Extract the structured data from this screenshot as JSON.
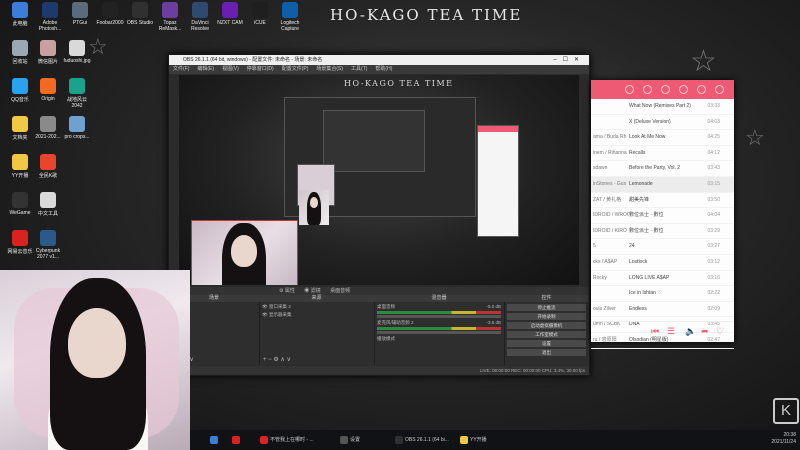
{
  "wallpaper": {
    "title": "HO-KAGO TEA TIME"
  },
  "desktop_icons": [
    {
      "label": "此电脑",
      "color": "#3b7dd8"
    },
    {
      "label": "Adobe Photosh...",
      "color": "#1c3a6e"
    },
    {
      "label": "PTGui",
      "color": "#5a6b7c"
    },
    {
      "label": "Foobar2000",
      "color": "#222222"
    },
    {
      "label": "OBS Studio",
      "color": "#303030"
    },
    {
      "label": "Topaz ReMask...",
      "color": "#6b3fa0"
    },
    {
      "label": "DaVinci Resolve",
      "color": "#2e4a70"
    },
    {
      "label": "NZXT CAM",
      "color": "#6a1fb0"
    },
    {
      "label": "iCUE",
      "color": "#1f1f1f"
    },
    {
      "label": "Logitech Capture",
      "color": "#0e5fa8"
    },
    {
      "label": "回收站",
      "color": "#9aa8b5"
    },
    {
      "label": "微信图片",
      "color": "#c8a0a0"
    },
    {
      "label": "fuduoshi.jpg",
      "color": "#d9d9d9"
    },
    {
      "label": "QQ音乐",
      "color": "#2aa3ef"
    },
    {
      "label": "Origin",
      "color": "#f26b21"
    },
    {
      "label": "战地风云 2042",
      "color": "#1aa38c"
    },
    {
      "label": "文档夹",
      "color": "#f2c744"
    },
    {
      "label": "2021-202...",
      "color": "#8a8a8a"
    },
    {
      "label": "pro crops...",
      "color": "#6fa0d0"
    },
    {
      "label": "YY开播",
      "color": "#f2c744"
    },
    {
      "label": "全民K歌",
      "color": "#e8452c"
    },
    {
      "label": "WeGame",
      "color": "#333333"
    },
    {
      "label": "中文工具",
      "color": "#d9d9d9"
    },
    {
      "label": "网易云音乐",
      "color": "#d8231f"
    },
    {
      "label": "Cyberpunk 2077 v1...",
      "color": "#2a5a8a"
    }
  ],
  "obs": {
    "window_title": "OBS 26.1.1 (64 bit, windows) - 配置文件: 未命名 - 场景: 未命名",
    "menu": [
      "文件(F)",
      "编辑(E)",
      "视图(V)",
      "停靠窗口(D)",
      "配置文件(P)",
      "场景集合(S)",
      "工具(T)",
      "帮助(H)"
    ],
    "inner_title": "HO-KAGO TEA TIME",
    "toolbar_props": "属性",
    "toolbar_filters": "滤镜",
    "toolbar_desktop": "桌面音频",
    "docks": {
      "scenes": "场景",
      "sources": "来源",
      "mixer": "混音器",
      "transitions": "转场",
      "controls": "控件"
    },
    "sources": [
      "窗口采集 2",
      "显示器采集"
    ],
    "mixer": [
      {
        "name": "桌面音频",
        "db": "-5.0 dB"
      },
      {
        "name": "麦克风/辅助音频 2",
        "db": "-3.5 dB"
      }
    ],
    "mixer_extra": "播放模式",
    "transition_level": "-17.4 dB",
    "controls": [
      "停止推流",
      "开始录制",
      "启动虚拟摄像机",
      "工作室模式",
      "设置",
      "退出"
    ],
    "status": "LIVE: 00:00:00   REC: 00:00:00   CPU: 3.4%, 30.00 fps"
  },
  "music": {
    "tracks": [
      {
        "artist": "",
        "title": "What Now (Remixes Part 2)",
        "duration": "03:33"
      },
      {
        "artist": "",
        "title": "X (Deluxe Version)",
        "duration": "04:03"
      },
      {
        "artist": "ama / Buda Rh",
        "title": "Look At Me Now",
        "duration": "04:25"
      },
      {
        "artist": "inem / Rihanna",
        "title": "Recalls",
        "duration": "04:12"
      },
      {
        "artist": "sdawn",
        "title": "Before the Party, Vol. 2",
        "duration": "03:43"
      },
      {
        "artist": "inStones - Gus",
        "title": "Lemonade",
        "duration": "03:15"
      },
      {
        "artist": "ZAT / 黄礼格",
        "title": "甜美先锋",
        "duration": "03:50"
      },
      {
        "artist": "IDROID / WROC",
        "title": "數位派士 · 數位",
        "duration": "04:04"
      },
      {
        "artist": "IDROID / KIRO",
        "title": "數位派士 · 數位",
        "duration": "03:29"
      },
      {
        "artist": "5",
        "title": "24",
        "duration": "03:27"
      },
      {
        "artist": "cks / A$AP",
        "title": "Lostlock",
        "duration": "03:12"
      },
      {
        "artist": "Rocky",
        "title": "LONG LIVE A$AP",
        "duration": "03:16"
      },
      {
        "artist": "",
        "title": "Ice in Ishtan ♡",
        "duration": "02:22"
      },
      {
        "artist": "ouis Zilver",
        "title": "Endless",
        "duration": "02:09"
      },
      {
        "artist": "umn / SCBK",
        "title": "DNA",
        "duration": "03:45"
      },
      {
        "artist": "ru / 岩原阳",
        "title": "Olsodian (明星版)",
        "duration": "02:47"
      }
    ],
    "accent": "#ee5a73"
  },
  "taskbar": {
    "items": [
      {
        "label": "",
        "color": "#3b7dd8"
      },
      {
        "label": "",
        "color": "#d8231f"
      },
      {
        "label": "不管我上在哪时 - ...",
        "color": "#d8231f"
      },
      {
        "label": "设置",
        "color": "#555555"
      },
      {
        "label": "OBS 26.1.1 (64 bi...",
        "color": "#303030"
      },
      {
        "label": "YY开播",
        "color": "#f2c744"
      }
    ],
    "time": "20:38",
    "date": "2021/11/24"
  }
}
